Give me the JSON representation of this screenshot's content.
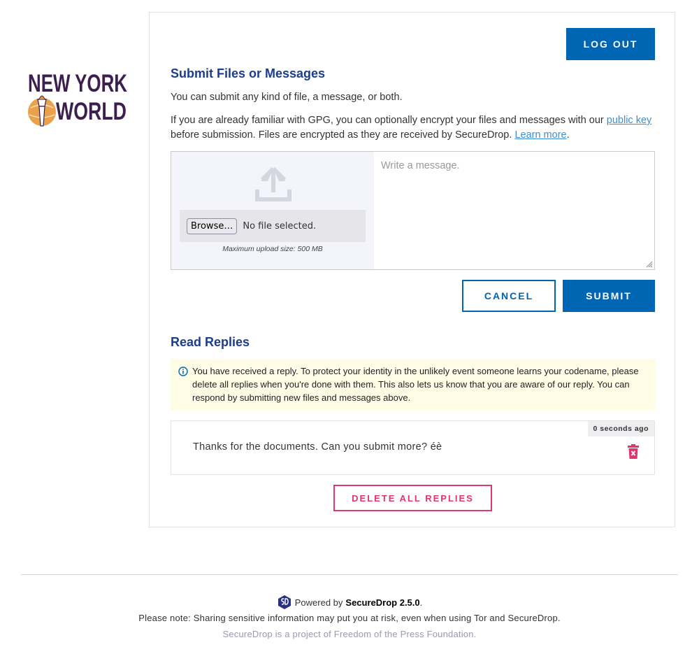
{
  "logo": {
    "line1": "NEW YORK",
    "line2": "WORLD"
  },
  "header": {
    "logout_label": "LOG OUT"
  },
  "submit_section": {
    "heading": "Submit Files or Messages",
    "intro": "You can submit any kind of file, a message, or both.",
    "gpg_text_before": "If you are already familiar with GPG, you can optionally encrypt your files and messages with our ",
    "public_key_link": "public key",
    "gpg_text_middle": " before submission. Files are encrypted as they are received by SecureDrop. ",
    "learn_more_link": "Learn more",
    "gpg_text_end": ".",
    "browse_label": "Browse…",
    "file_status": "No file selected.",
    "max_upload": "Maximum upload size: 500 MB",
    "message_placeholder": "Write a message.",
    "cancel_label": "CANCEL",
    "submit_label": "SUBMIT"
  },
  "replies_section": {
    "heading": "Read Replies",
    "notice": "You have received a reply. To protect your identity in the unlikely event someone learns your codename, please delete all replies when you're done with them. This also lets us know that you are aware of our reply. You can respond by submitting new files and messages above.",
    "replies": [
      {
        "time": "0 seconds ago",
        "text": "Thanks for the documents. Can you submit more? éè"
      }
    ],
    "delete_all_label": "DELETE ALL REPLIES"
  },
  "footer": {
    "powered_prefix": "Powered by",
    "powered_product": "SecureDrop 2.5.0",
    "powered_suffix": ".",
    "note": "Please note: Sharing sensitive information may put you at risk, even when using Tor and SecureDrop.",
    "project": "SecureDrop is a project of Freedom of the Press Foundation."
  },
  "colors": {
    "primary": "#0065b3",
    "heading": "#1c3d8f",
    "danger": "#e0366d",
    "notice_bg": "#fffde6",
    "logo_purple": "#3b1f4f",
    "logo_orange": "#e8902a"
  }
}
